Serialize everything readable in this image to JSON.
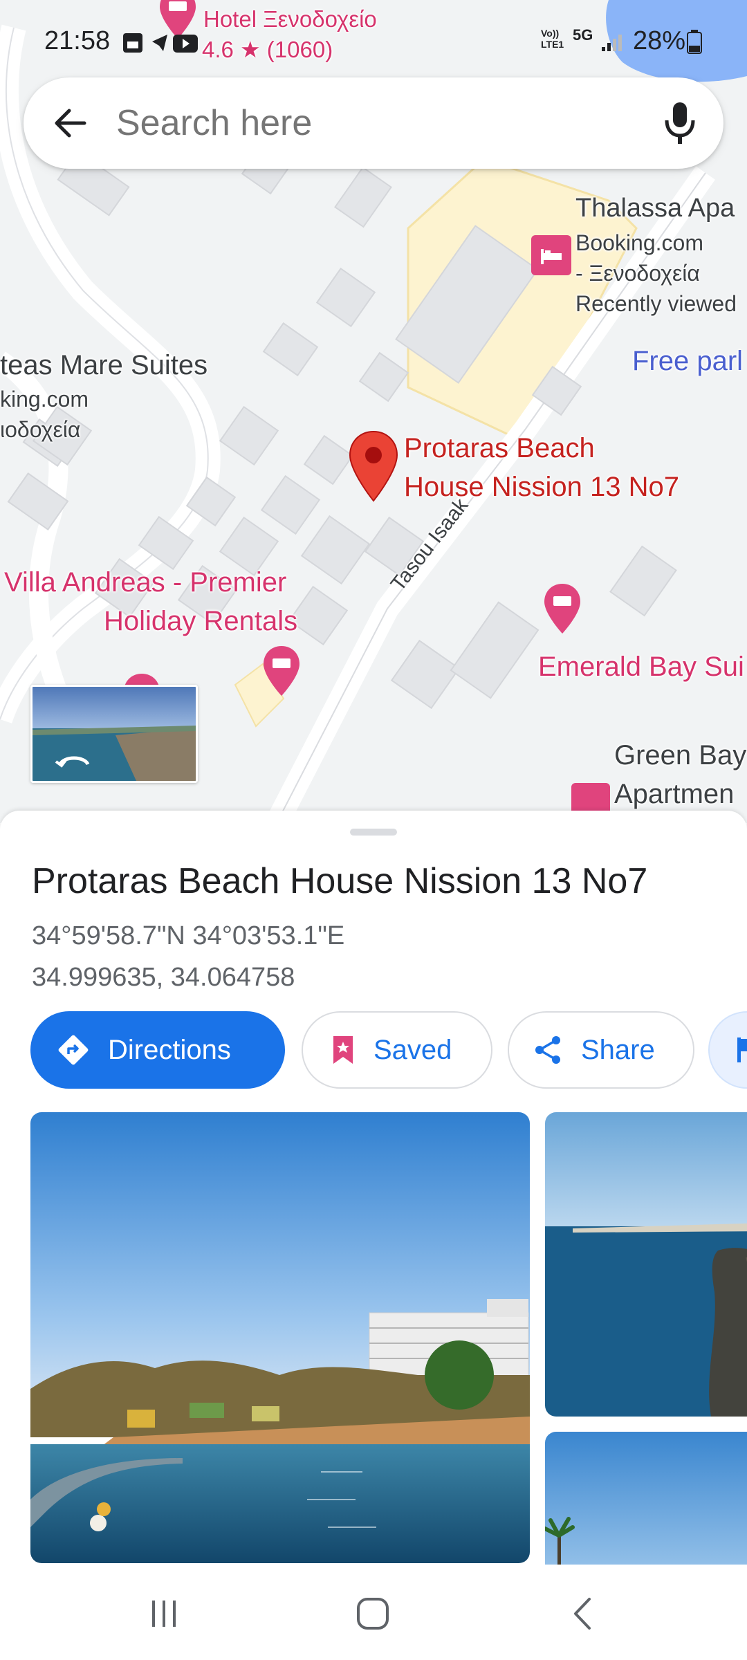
{
  "status_bar": {
    "time": "21:58",
    "network": "5G",
    "volte": "Vo))",
    "lte": "LTE1",
    "battery": "28%"
  },
  "search": {
    "placeholder": "Search here"
  },
  "map": {
    "top_poi": {
      "name": "Hotel Ξενοδοχείο",
      "rating": "4.6 ★ (1060)"
    },
    "thalassa": {
      "name": "Thalassa Apa",
      "line1": "Booking.com",
      "line2": "- Ξενοδοχεία",
      "line3": "Recently viewed"
    },
    "free_parking": "Free parl",
    "protea": {
      "name": "teas Mare Suites",
      "line1": "king.com",
      "line2": "ιοδοχεία"
    },
    "selected_pin": {
      "line1": "Protaras Beach",
      "line2": "House Nission 13 No7"
    },
    "villa": {
      "line1": "Villa Andreas - Premier",
      "line2": "Holiday Rentals"
    },
    "street": "Tasou Isaak",
    "emerald": "Emerald Bay Sui",
    "green_bay": {
      "line1": "Green Bay",
      "line2": "Apartmen"
    }
  },
  "place": {
    "title": "Protaras Beach House Nission 13 No7",
    "coords_dms": "34°59'58.7\"N 34°03'53.1\"E",
    "coords_decimal": "34.999635, 34.064758"
  },
  "actions": {
    "directions": "Directions",
    "saved": "Saved",
    "share": "Share"
  },
  "colors": {
    "accent": "#1a73e8",
    "hotel_pink": "#e0447d",
    "pin_red": "#ea4335"
  }
}
